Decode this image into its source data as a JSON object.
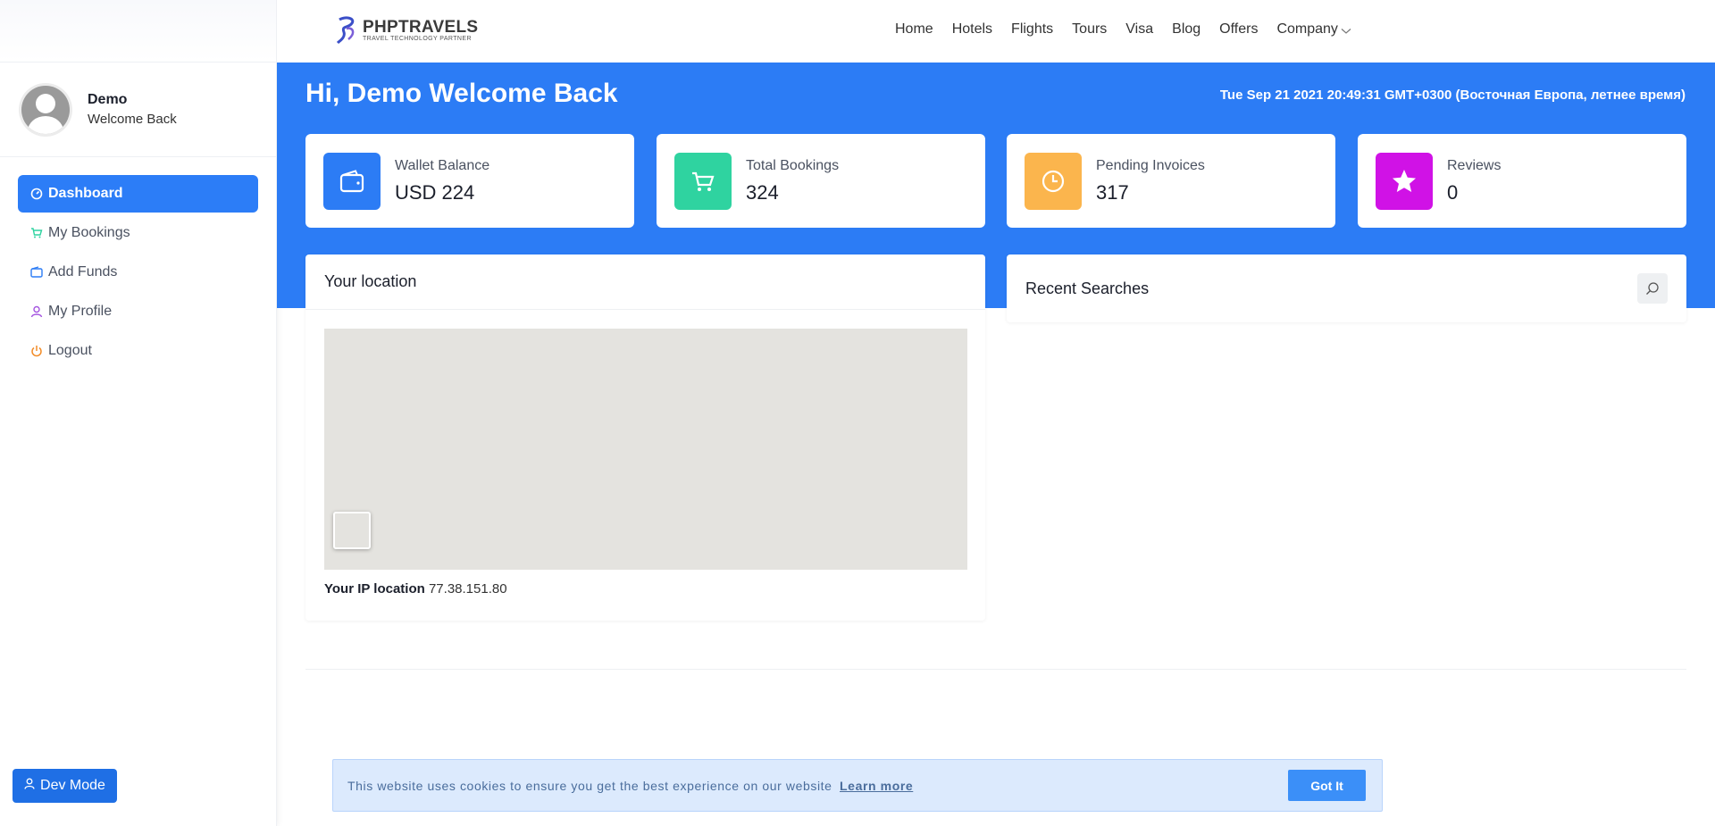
{
  "header": {
    "brand_title": "PHPTRAVELS",
    "brand_subtitle": "TRAVEL TECHNOLOGY PARTNER",
    "nav": [
      "Home",
      "Hotels",
      "Flights",
      "Tours",
      "Visa",
      "Blog",
      "Offers",
      "Company"
    ]
  },
  "sidebar": {
    "user_name": "Demo",
    "user_sub": "Welcome Back",
    "items": [
      {
        "label": "Dashboard",
        "icon": "dashboard-icon"
      },
      {
        "label": "My Bookings",
        "icon": "cart-icon"
      },
      {
        "label": "Add Funds",
        "icon": "wallet-icon"
      },
      {
        "label": "My Profile",
        "icon": "user-icon"
      },
      {
        "label": "Logout",
        "icon": "power-icon"
      }
    ],
    "dev_mode": "Dev Mode"
  },
  "dashboard": {
    "greeting": "Hi, Demo Welcome Back",
    "datetime": "Tue Sep 21 2021 20:49:31 GMT+0300 (Восточная Европа, летнее время)",
    "stats": [
      {
        "label": "Wallet Balance",
        "value": "USD 224",
        "color": "#2c7cf5",
        "icon": "wallet-icon"
      },
      {
        "label": "Total Bookings",
        "value": "324",
        "color": "#2fd3a0",
        "icon": "cart-icon"
      },
      {
        "label": "Pending Invoices",
        "value": "317",
        "color": "#fbb54d",
        "icon": "clock-icon"
      },
      {
        "label": "Reviews",
        "value": "0",
        "color": "#d012e6",
        "icon": "star-icon"
      }
    ],
    "location_title": "Your location",
    "ip_label": "Your IP location",
    "ip_value": "77.38.151.80",
    "recent_title": "Recent Searches"
  },
  "cookie": {
    "text": "This website uses cookies to ensure you get the best experience on our website",
    "link": "Learn more",
    "button": "Got It"
  },
  "colors": {
    "accent": "#2c7cf5"
  }
}
